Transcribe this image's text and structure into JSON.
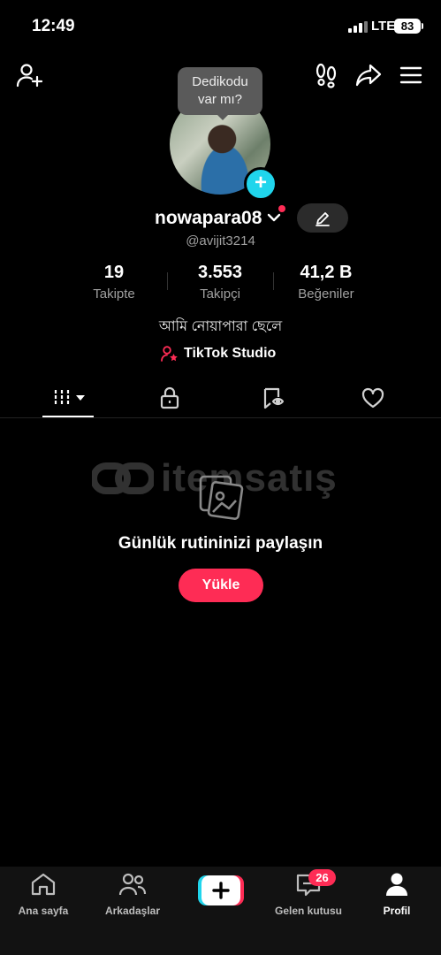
{
  "status_bar": {
    "time": "12:49",
    "network": "LTE",
    "battery": "83"
  },
  "header": {
    "tooltip_line1": "Dedikodu",
    "tooltip_line2": "var mı?"
  },
  "profile": {
    "username": "nowapara08",
    "handle": "@avijit3214",
    "bio": "আমি নোয়াপারা ছেলে",
    "studio_label": "TikTok Studio"
  },
  "stats": [
    {
      "value": "19",
      "label": "Takipte"
    },
    {
      "value": "3.553",
      "label": "Takipçi"
    },
    {
      "value": "41,2 B",
      "label": "Beğeniler"
    }
  ],
  "watermark": "itemsatış",
  "empty_state": {
    "title": "Günlük rutininizi paylaşın",
    "button": "Yükle"
  },
  "bottom_nav": {
    "home": "Ana sayfa",
    "friends": "Arkadaşlar",
    "inbox": "Gelen kutusu",
    "inbox_badge": "26",
    "profile": "Profil"
  },
  "colors": {
    "accent": "#fe2c55",
    "cyan": "#20d5ec"
  }
}
